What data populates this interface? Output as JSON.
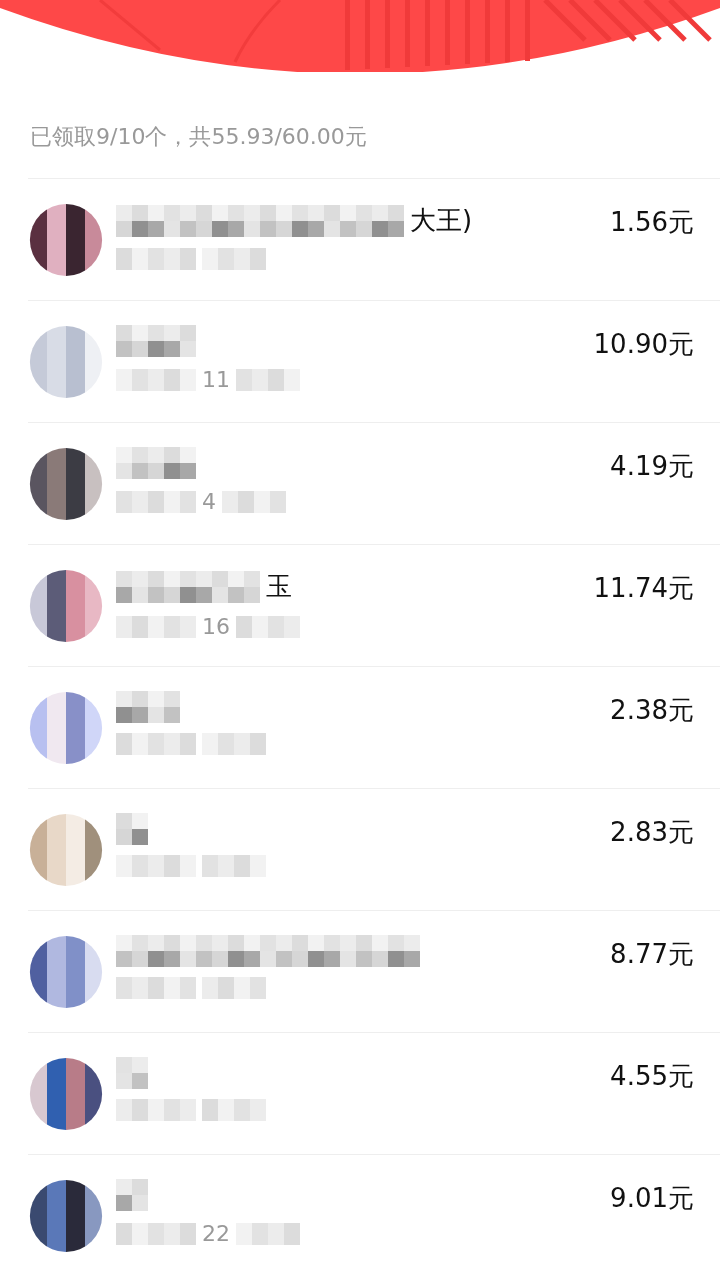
{
  "summary": "已领取9/10个，共55.93/60.00元",
  "records": [
    {
      "name_fragment": "大王)",
      "amount": "1.56元"
    },
    {
      "time_fragment": "11",
      "amount": "10.90元"
    },
    {
      "time_fragment": "4",
      "amount": "4.19元"
    },
    {
      "name_fragment": "玉",
      "time_fragment": "16",
      "amount": "11.74元"
    },
    {
      "amount": "2.38元"
    },
    {
      "amount": "2.83元"
    },
    {
      "amount": "8.77元"
    },
    {
      "amount": "4.55元"
    },
    {
      "time_fragment": "22",
      "amount": "9.01元"
    }
  ]
}
